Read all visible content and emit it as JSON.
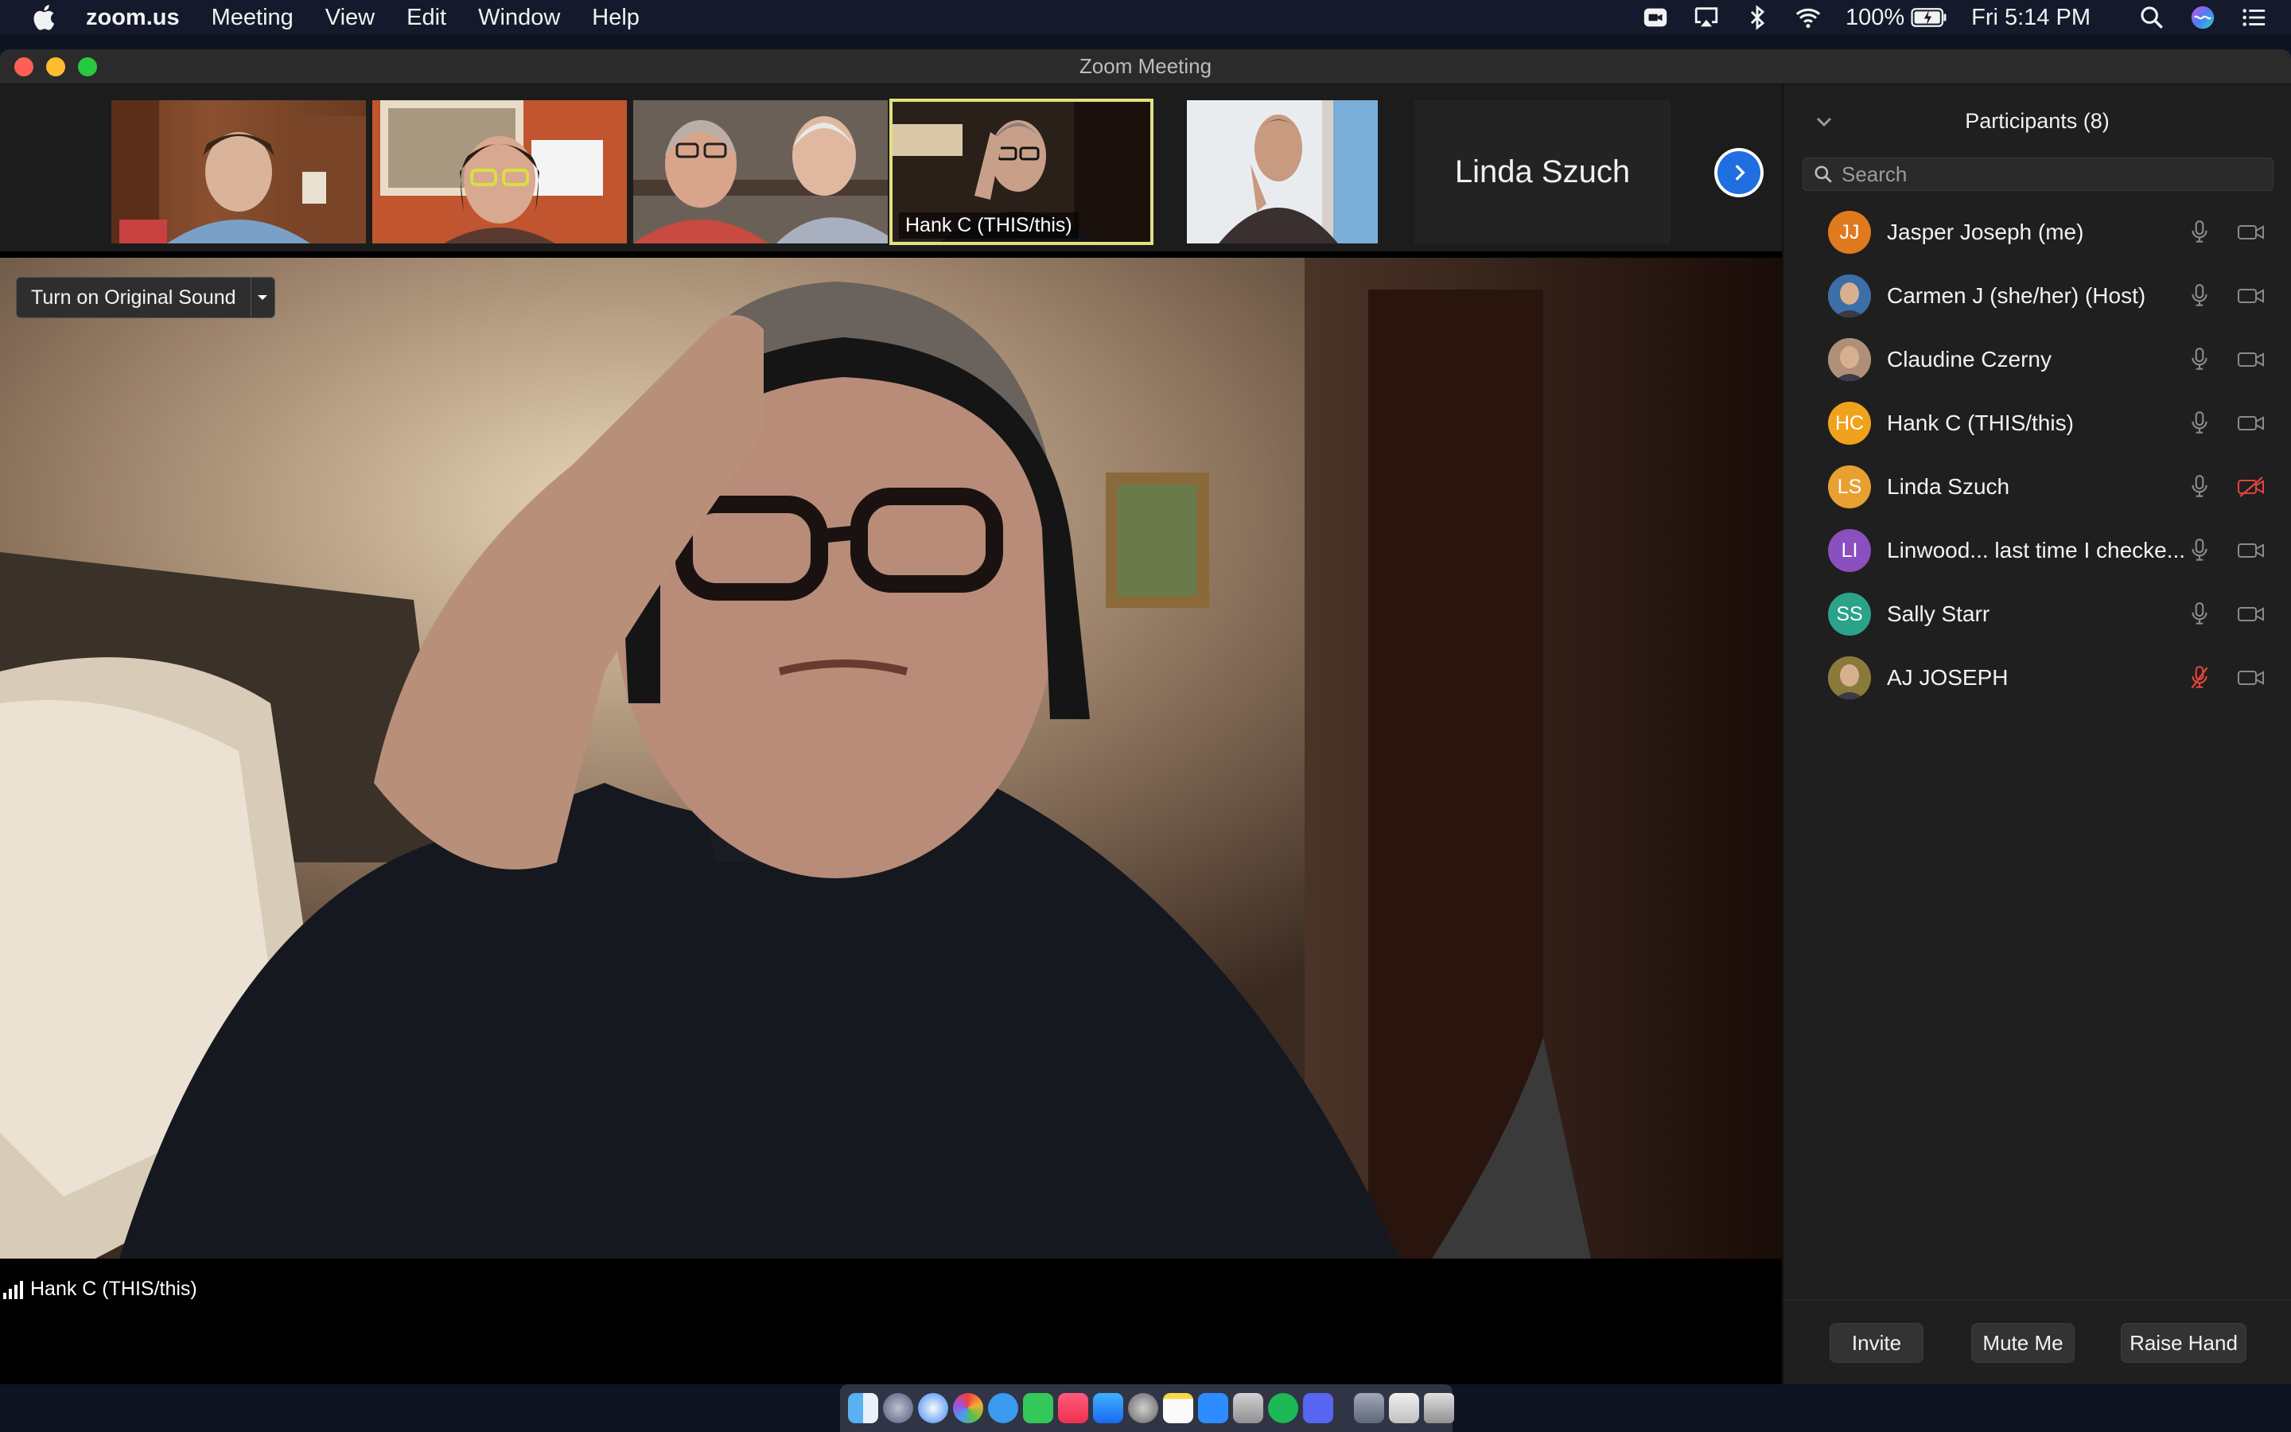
{
  "menubar": {
    "app_name": "zoom.us",
    "items": [
      "Meeting",
      "View",
      "Edit",
      "Window",
      "Help"
    ],
    "battery": "100%",
    "clock": "Fri 5:14 PM"
  },
  "window": {
    "title": "Zoom Meeting"
  },
  "thumbnails": {
    "active_name": "Hank C (THIS/this)",
    "text_tile": "Linda Szuch"
  },
  "main_video": {
    "original_sound_button": "Turn on Original Sound",
    "speaker_name": "Hank C (THIS/this)"
  },
  "participants": {
    "title": "Participants (8)",
    "search_placeholder": "Search",
    "items": [
      {
        "initials": "JJ",
        "name": "Jasper Joseph (me)",
        "color": "#e07a1f",
        "mic_muted": false,
        "video_off": false
      },
      {
        "initials": "",
        "name": "Carmen J (she/her) (Host)",
        "color": "#3c6ea8",
        "mic_muted": false,
        "video_off": false
      },
      {
        "initials": "",
        "name": "Claudine Czerny",
        "color": "#b08f79",
        "mic_muted": false,
        "video_off": false
      },
      {
        "initials": "HC",
        "name": "Hank C (THIS/this)",
        "color": "#f0a21c",
        "mic_muted": false,
        "video_off": false
      },
      {
        "initials": "LS",
        "name": "Linda Szuch",
        "color": "#e8a030",
        "mic_muted": false,
        "video_off": true
      },
      {
        "initials": "LI",
        "name": "Linwood... last time I checke...",
        "color": "#8b4fbf",
        "mic_muted": false,
        "video_off": false
      },
      {
        "initials": "SS",
        "name": "Sally Starr",
        "color": "#2aa38a",
        "mic_muted": false,
        "video_off": false
      },
      {
        "initials": "",
        "name": "AJ JOSEPH",
        "color": "#8a7a3a",
        "mic_muted": true,
        "video_off": false
      }
    ],
    "footer": {
      "invite": "Invite",
      "mute_me": "Mute Me",
      "raise_hand": "Raise Hand"
    }
  },
  "colors": {
    "active_border": "#e2e07c",
    "muted_red": "#e0453a",
    "accent_blue": "#1f6fe0"
  }
}
